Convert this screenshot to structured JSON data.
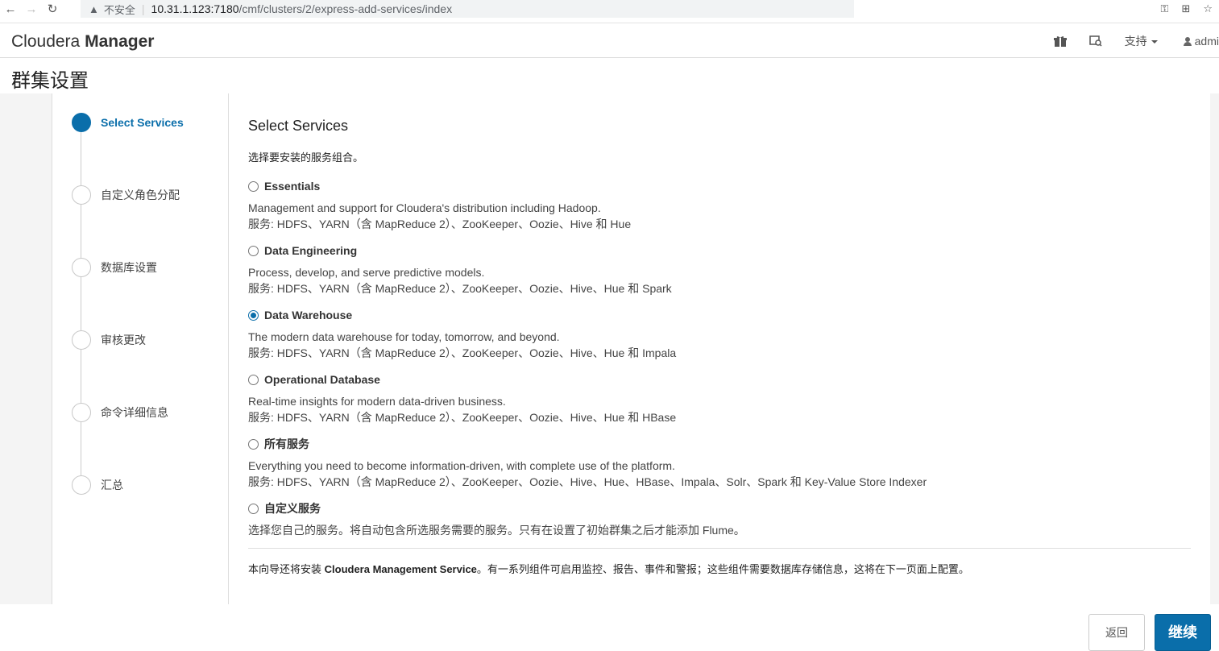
{
  "browser": {
    "back_icon": "←",
    "forward_icon": "→",
    "reload_icon": "↻",
    "security_warning": "▲",
    "security_text": "不安全",
    "url_host": "10.31.1.123:7180",
    "url_path": "/cmf/clusters/2/express-add-services/index",
    "key_icon": "⚿",
    "translate_icon": "⊞",
    "star_icon": "☆"
  },
  "header": {
    "brand_light": "Cloudera",
    "brand_bold": "Manager",
    "support_label": "支持",
    "user_label": "admi"
  },
  "page": {
    "title": "群集设置"
  },
  "steps": [
    {
      "label": "Select Services",
      "active": true
    },
    {
      "label": "自定义角色分配",
      "active": false
    },
    {
      "label": "数据库设置",
      "active": false
    },
    {
      "label": "审核更改",
      "active": false
    },
    {
      "label": "命令详细信息",
      "active": false
    },
    {
      "label": "汇总",
      "active": false
    }
  ],
  "main": {
    "title": "Select Services",
    "description": "选择要安装的服务组合。",
    "options": [
      {
        "name": "Essentials",
        "checked": false,
        "desc": "Management and support for Cloudera's distribution including Hadoop.",
        "services": "服务: HDFS、YARN（含 MapReduce 2）、ZooKeeper、Oozie、Hive 和 Hue"
      },
      {
        "name": "Data Engineering",
        "checked": false,
        "desc": "Process, develop, and serve predictive models.",
        "services": "服务: HDFS、YARN（含 MapReduce 2）、ZooKeeper、Oozie、Hive、Hue 和 Spark"
      },
      {
        "name": "Data Warehouse",
        "checked": true,
        "desc": "The modern data warehouse for today, tomorrow, and beyond.",
        "services": "服务: HDFS、YARN（含 MapReduce 2）、ZooKeeper、Oozie、Hive、Hue 和 Impala"
      },
      {
        "name": "Operational Database",
        "checked": false,
        "desc": "Real-time insights for modern data-driven business.",
        "services": "服务: HDFS、YARN（含 MapReduce 2）、ZooKeeper、Oozie、Hive、Hue 和 HBase"
      },
      {
        "name": "所有服务",
        "checked": false,
        "desc": "Everything you need to become information-driven, with complete use of the platform.",
        "services": "服务: HDFS、YARN（含 MapReduce 2）、ZooKeeper、Oozie、Hive、Hue、HBase、Impala、Solr、Spark 和 Key-Value Store Indexer"
      },
      {
        "name": "自定义服务",
        "checked": false,
        "desc": "选择您自己的服务。将自动包含所选服务需要的服务。只有在设置了初始群集之后才能添加 Flume。",
        "services": ""
      }
    ],
    "footer_pre": "本向导还将安装 ",
    "footer_bold": "Cloudera Management Service",
    "footer_post": "。有一系列组件可启用监控、报告、事件和警报；这些组件需要数据库存储信息，这将在下一页面上配置。"
  },
  "buttons": {
    "back": "返回",
    "continue": "继续"
  }
}
